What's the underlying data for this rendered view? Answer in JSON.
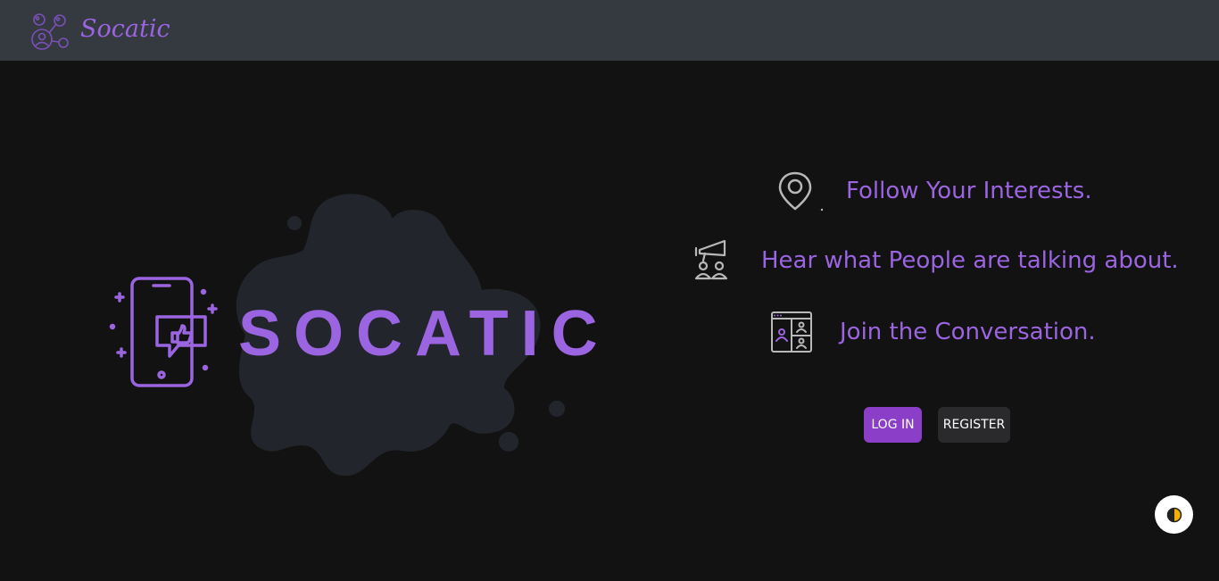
{
  "navbar": {
    "brand_text": "Socatic",
    "brand_logo_icon": "social-network-icon"
  },
  "hero": {
    "logo_text": "SOCATIC",
    "phone_icon": "phone-thumbs-up-icon",
    "splash_color": "#22262c"
  },
  "features": [
    {
      "icon": "map-pin-icon",
      "text": "Follow Your Interests."
    },
    {
      "icon": "megaphone-people-icon",
      "text": "Hear what People are talking about."
    },
    {
      "icon": "video-call-icon",
      "text": "Join the Conversation."
    }
  ],
  "actions": {
    "login_label": "LOG IN",
    "register_label": "REGISTER"
  },
  "theme_toggle": {
    "icon": "contrast-icon"
  },
  "colors": {
    "accent": "#9b64e0",
    "navbar_bg": "#343a40",
    "page_bg": "#121212",
    "login_bg": "#8b3fc8",
    "register_bg": "#2a2a2c"
  }
}
